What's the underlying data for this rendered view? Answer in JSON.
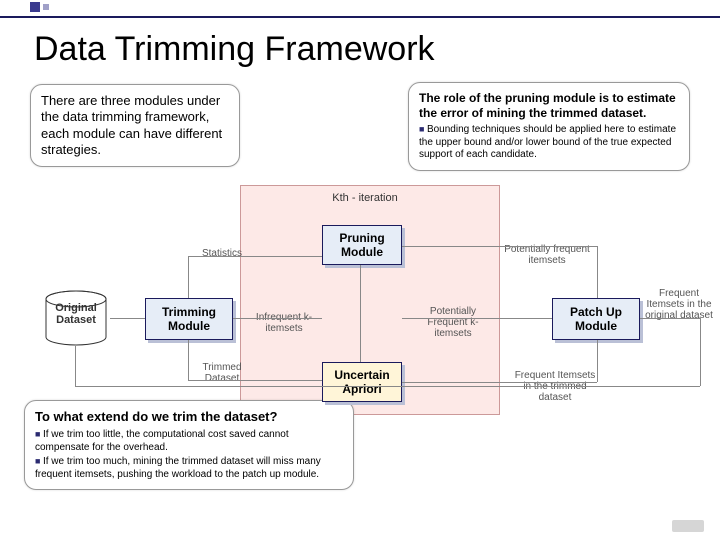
{
  "title": "Data Trimming Framework",
  "callouts": {
    "intro": "There are three modules under the data trimming framework, each module can have different strategies.",
    "role_hdr": "The role of the pruning module is to estimate the error of mining the trimmed dataset.",
    "role_bullet": "Bounding techniques should be applied here to estimate the upper bound and/or lower bound of the true expected support of each candidate.",
    "trim_q": "To what extend do we trim the dataset?",
    "trim_b1": "If we trim too little, the computational cost saved cannot compensate for the overhead.",
    "trim_b2": "If we trim too much, mining the trimmed dataset will miss many frequent itemsets, pushing the workload to the patch up module."
  },
  "labels": {
    "original_dataset": "Original Dataset",
    "statistics": "Statistics",
    "kth_iteration": "Kth - iteration",
    "infrequent": "Infrequent k-itemsets",
    "potentially_frequent_k": "Potentially Frequent k-itemsets",
    "potentially_frequent": "Potentially frequent itemsets",
    "frequent_trimmed": "Frequent Itemsets in the trimmed dataset",
    "frequent_original": "Frequent Itemsets in the original dataset",
    "trimmed_dataset": "Trimmed Dataset"
  },
  "modules": {
    "trimming": "Trimming Module",
    "pruning": "Pruning Module",
    "uncertain": "Uncertain Apriori",
    "patchup": "Patch Up Module"
  }
}
